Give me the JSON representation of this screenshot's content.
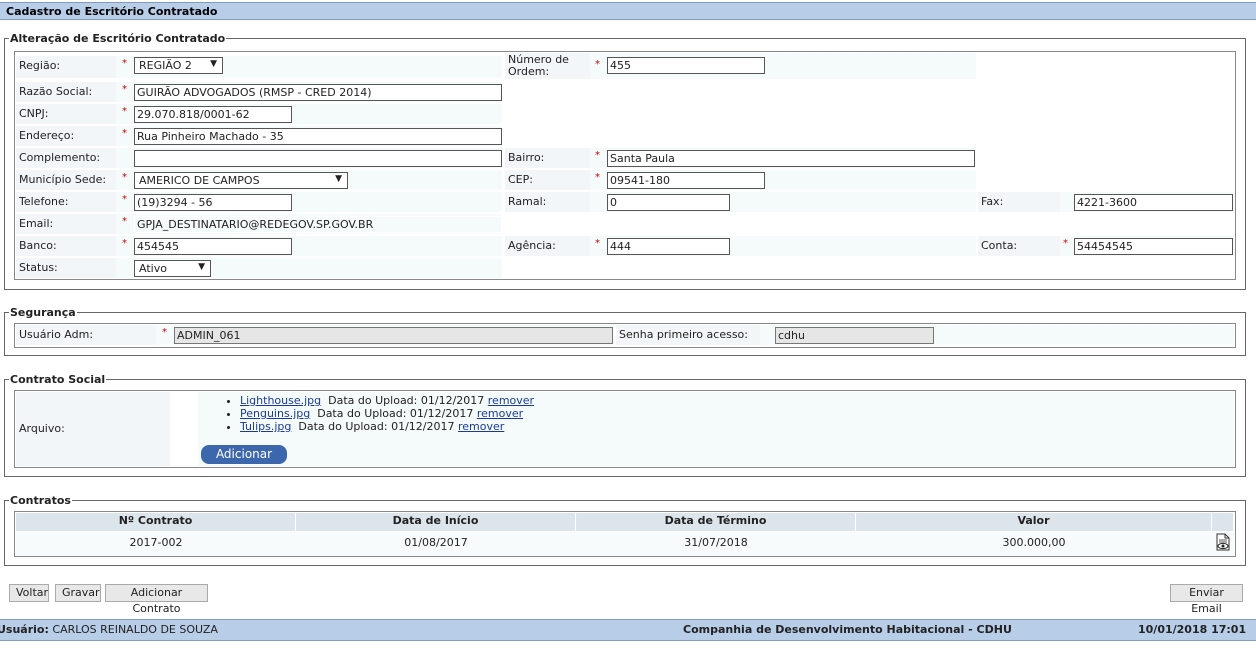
{
  "header": {
    "title": "Cadastro de Escritório Contratado"
  },
  "alteracao": {
    "legend": "Alteração de Escritório Contratado",
    "regiao": {
      "label": "Região:",
      "value": "REGIÃO 2"
    },
    "numero_ordem": {
      "label": "Número de Ordem:",
      "value": "455"
    },
    "razao_social": {
      "label": "Razão Social:",
      "value": "GUIRÃO ADVOGADOS (RMSP - CRED 2014)"
    },
    "cnpj": {
      "label": "CNPJ:",
      "value": "29.070.818/0001-62"
    },
    "endereco": {
      "label": "Endereço:",
      "value": "Rua Pinheiro Machado -  35"
    },
    "complemento": {
      "label": "Complemento:",
      "value": ""
    },
    "bairro": {
      "label": "Bairro:",
      "value": "Santa Paula"
    },
    "municipio": {
      "label": "Município Sede:",
      "value": "AMERICO DE CAMPOS"
    },
    "cep": {
      "label": "CEP:",
      "value": "09541-180"
    },
    "telefone": {
      "label": "Telefone:",
      "value": "(19)3294 - 56"
    },
    "ramal": {
      "label": "Ramal:",
      "value": "0"
    },
    "fax": {
      "label": "Fax:",
      "value": "4221-3600"
    },
    "email": {
      "label": "Email:",
      "value": "GPJA_DESTINATARIO@REDEGOV.SP.GOV.BR"
    },
    "banco": {
      "label": "Banco:",
      "value": "454545"
    },
    "agencia": {
      "label": "Agência:",
      "value": "444"
    },
    "conta": {
      "label": "Conta:",
      "value": "54454545"
    },
    "status": {
      "label": "Status:",
      "value": "Ativo"
    }
  },
  "seguranca": {
    "legend": "Segurança",
    "usuario_adm": {
      "label": "Usuário Adm:",
      "value": "ADMIN_061"
    },
    "senha": {
      "label": "Senha primeiro acesso:",
      "value": "cdhu"
    }
  },
  "contrato_social": {
    "legend": "Contrato Social",
    "arquivo_label": "Arquivo:",
    "files": [
      {
        "name": "Lighthouse.jpg",
        "upload_text": "Data do Upload: 01/12/2017",
        "remove": "remover"
      },
      {
        "name": "Penguins.jpg",
        "upload_text": "Data do Upload: 01/12/2017",
        "remove": "remover"
      },
      {
        "name": "Tulips.jpg",
        "upload_text": "Data do Upload: 01/12/2017",
        "remove": "remover"
      }
    ],
    "add_label": "Adicionar"
  },
  "contratos": {
    "legend": "Contratos",
    "columns": [
      "Nº Contrato",
      "Data de Início",
      "Data de Término",
      "Valor"
    ],
    "rows": [
      {
        "numero": "2017-002",
        "inicio": "01/08/2017",
        "termino": "31/07/2018",
        "valor": "300.000,00"
      }
    ]
  },
  "actions": {
    "voltar": "Voltar",
    "gravar": "Gravar",
    "adicionar_contrato": "Adicionar Contrato",
    "enviar_email": "Enviar Email"
  },
  "footer": {
    "usuario_label": "Usuário:",
    "usuario_name": "CARLOS REINALDO DE SOUZA",
    "company": "Companhia de Desenvolvimento Habitacional - CDHU",
    "datetime": "10/01/2018 17:01"
  }
}
